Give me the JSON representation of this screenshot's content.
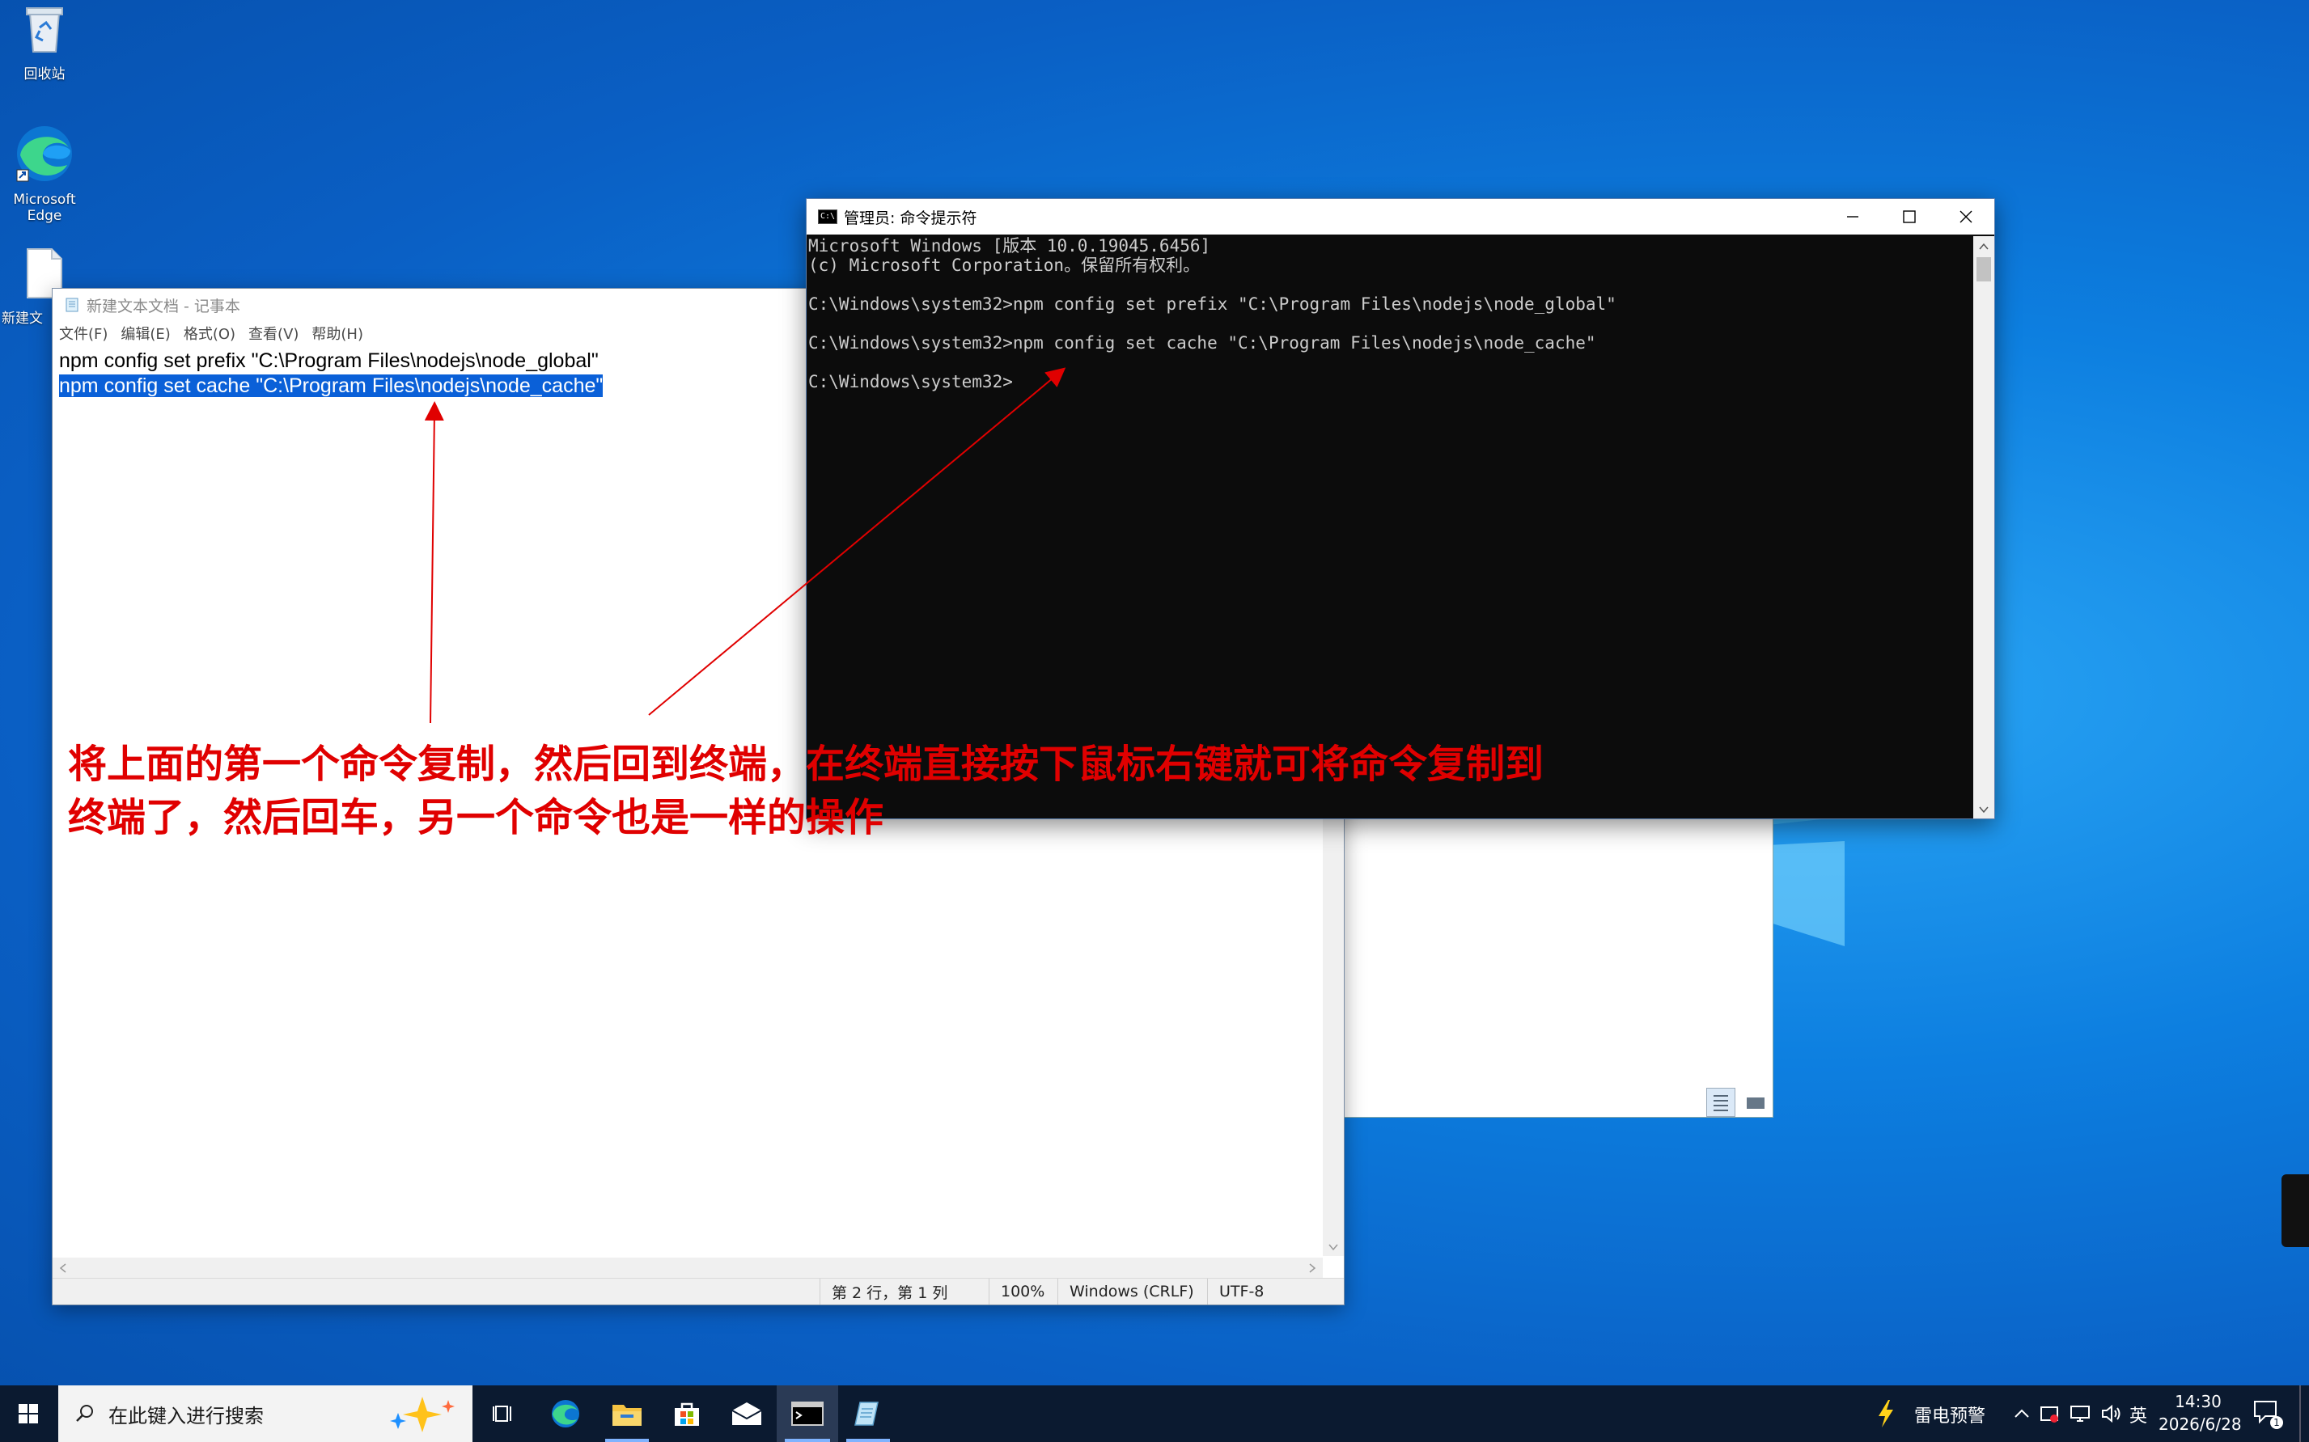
{
  "desktop": {
    "icons": [
      {
        "label": "回收站",
        "icon": "recycle-bin-icon"
      },
      {
        "label": "Microsoft Edge",
        "label_l1": "Microsoft",
        "label_l2": "Edge",
        "icon": "edge-icon"
      },
      {
        "label": "新建文",
        "icon": "text-file-icon"
      }
    ]
  },
  "notepad": {
    "title": "新建文本文档 - 记事本",
    "menu": [
      "文件(F)",
      "编辑(E)",
      "格式(O)",
      "查看(V)",
      "帮助(H)"
    ],
    "lines": [
      "npm config set prefix \"C:\\Program Files\\nodejs\\node_global\"",
      "npm config set cache \"C:\\Program Files\\nodejs\\node_cache\""
    ],
    "status": {
      "position": "第 2 行，第 1 列",
      "zoom": "100%",
      "line_ending": "Windows (CRLF)",
      "encoding": "UTF-8"
    }
  },
  "cmd": {
    "title": "管理员: 命令提示符",
    "icon_text": "C:\\",
    "lines": [
      "Microsoft Windows [版本 10.0.19045.6456]",
      "(c) Microsoft Corporation。保留所有权利。",
      "",
      "C:\\Windows\\system32>npm config set prefix \"C:\\Program Files\\nodejs\\node_global\"",
      "",
      "C:\\Windows\\system32>npm config set cache \"C:\\Program Files\\nodejs\\node_cache\"",
      "",
      "C:\\Windows\\system32>"
    ]
  },
  "annotation": {
    "line1": "将上面的第一个命令复制，然后回到终端，在终端直接按下鼠标右键就可将命令复制到",
    "line2": "终端了，然后回车，另一个命令也是一样的操作",
    "color": "#e00000"
  },
  "taskbar": {
    "search_placeholder": "在此键入进行搜索",
    "weather": "雷电预警",
    "ime": "英",
    "time": "14:30",
    "date": "2026/6/28",
    "notification_count": "1"
  }
}
